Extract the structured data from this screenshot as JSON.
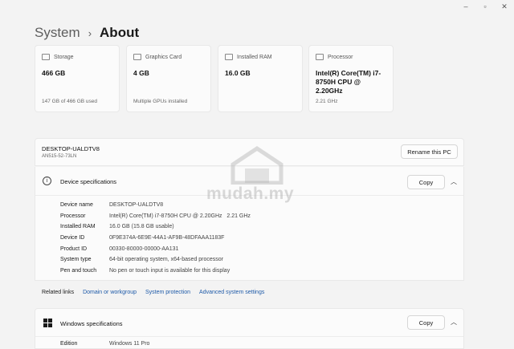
{
  "window": {
    "minimize": "–",
    "maximize": "▫",
    "close": "✕"
  },
  "breadcrumb": {
    "parent": "System",
    "separator": "›",
    "current": "About"
  },
  "cards": [
    {
      "icon": "storage-icon",
      "title": "Storage",
      "value": "466 GB",
      "sub": "147 GB of 466 GB used"
    },
    {
      "icon": "graphics-card-icon",
      "title": "Graphics Card",
      "value": "4 GB",
      "sub": "Multiple GPUs installed"
    },
    {
      "icon": "ram-icon",
      "title": "Installed RAM",
      "value": "16.0 GB",
      "sub": ""
    },
    {
      "icon": "processor-icon",
      "title": "Processor",
      "value": "Intel(R) Core(TM) i7-8750H CPU @ 2.20GHz",
      "sub": "2.21 GHz"
    }
  ],
  "device": {
    "name": "DESKTOP-UALDTV8",
    "model": "AN515-52-73LN",
    "rename_label": "Rename this PC"
  },
  "device_specs": {
    "title": "Device specifications",
    "copy_label": "Copy",
    "rows": [
      {
        "label": "Device name",
        "value": "DESKTOP-UALDTV8"
      },
      {
        "label": "Processor",
        "value": "Intel(R) Core(TM) i7-8750H CPU @ 2.20GHz   2.21 GHz"
      },
      {
        "label": "Installed RAM",
        "value": "16.0 GB (15.8 GB usable)"
      },
      {
        "label": "Device ID",
        "value": "0F9E374A-6E9E-44A1-AF9B-48DFAAA1183F"
      },
      {
        "label": "Product ID",
        "value": "00330-80000-00000-AA131"
      },
      {
        "label": "System type",
        "value": "64-bit operating system, x64-based processor"
      },
      {
        "label": "Pen and touch",
        "value": "No pen or touch input is available for this display"
      }
    ]
  },
  "related_links": {
    "label": "Related links",
    "links": [
      "Domain or workgroup",
      "System protection",
      "Advanced system settings"
    ]
  },
  "windows_specs": {
    "title": "Windows specifications",
    "copy_label": "Copy",
    "edition_label": "Edition",
    "edition_value": "Windows 11 Pro"
  },
  "watermark": {
    "text": "mudah.my"
  }
}
